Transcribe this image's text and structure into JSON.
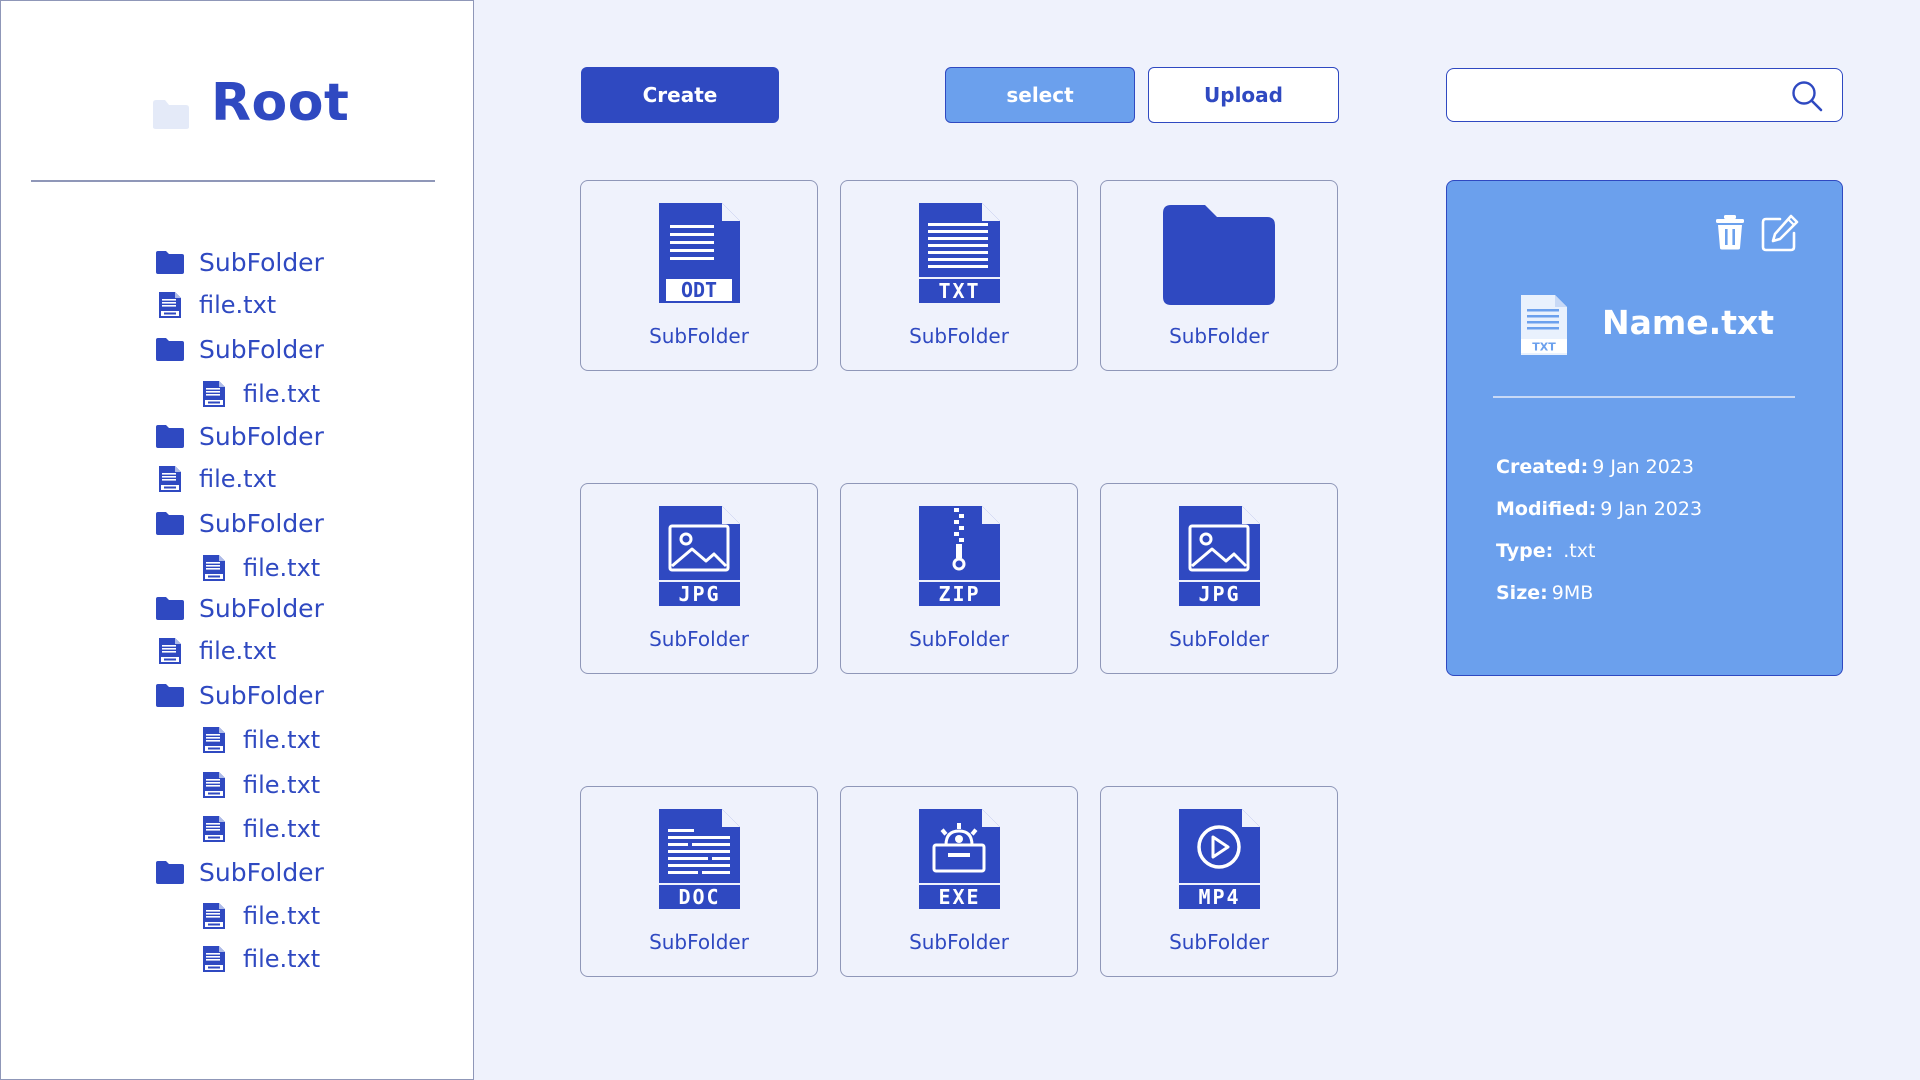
{
  "sidebar": {
    "title": "Root",
    "items": [
      {
        "type": "folder",
        "label": "SubFolder",
        "indent": 0
      },
      {
        "type": "file",
        "label": "file.txt",
        "indent": 0
      },
      {
        "type": "folder",
        "label": "SubFolder",
        "indent": 0
      },
      {
        "type": "file",
        "label": "file.txt",
        "indent": 1
      },
      {
        "type": "folder",
        "label": "SubFolder",
        "indent": 0
      },
      {
        "type": "file",
        "label": "file.txt",
        "indent": 0
      },
      {
        "type": "folder",
        "label": "SubFolder",
        "indent": 0
      },
      {
        "type": "file",
        "label": "file.txt",
        "indent": 1
      },
      {
        "type": "folder",
        "label": "SubFolder",
        "indent": 0
      },
      {
        "type": "file",
        "label": "file.txt",
        "indent": 0
      },
      {
        "type": "folder",
        "label": "SubFolder",
        "indent": 0
      },
      {
        "type": "file",
        "label": "file.txt",
        "indent": 1
      },
      {
        "type": "file",
        "label": "file.txt",
        "indent": 1
      },
      {
        "type": "file",
        "label": "file.txt",
        "indent": 1
      },
      {
        "type": "folder",
        "label": "SubFolder",
        "indent": 0
      },
      {
        "type": "file",
        "label": "file.txt",
        "indent": 1
      },
      {
        "type": "file",
        "label": "file.txt",
        "indent": 1
      }
    ]
  },
  "toolbar": {
    "create_label": "Create",
    "select_label": "select",
    "upload_label": "Upload"
  },
  "search": {
    "value": "",
    "placeholder": "",
    "icon": "search-icon"
  },
  "grid": {
    "tiles": [
      {
        "icon": "odt-file-icon",
        "badge": "ODT",
        "label": "SubFolder"
      },
      {
        "icon": "txt-file-icon",
        "badge": "TXT",
        "label": "SubFolder"
      },
      {
        "icon": "folder-icon",
        "badge": "",
        "label": "SubFolder"
      },
      {
        "icon": "jpg-file-icon",
        "badge": "JPG",
        "label": "SubFolder"
      },
      {
        "icon": "zip-file-icon",
        "badge": "ZIP",
        "label": "SubFolder"
      },
      {
        "icon": "jpg-file-icon",
        "badge": "JPG",
        "label": "SubFolder"
      },
      {
        "icon": "doc-file-icon",
        "badge": "DOC",
        "label": "SubFolder"
      },
      {
        "icon": "exe-file-icon",
        "badge": "EXE",
        "label": "SubFolder"
      },
      {
        "icon": "mp4-file-icon",
        "badge": "MP4",
        "label": "SubFolder"
      }
    ]
  },
  "details": {
    "name": "Name.txt",
    "icon_badge": "TXT",
    "created_label": "Created:",
    "created_value": "9 Jan 2023",
    "modified_label": "Modified:",
    "modified_value": "9 Jan 2023",
    "type_label": "Type:",
    "type_value": ".txt",
    "size_label": "Size:",
    "size_value": "9MB"
  },
  "colors": {
    "primary": "#2f49c1",
    "accent": "#6ba0ed",
    "background": "#eff2fc",
    "border": "#8f97b8"
  }
}
